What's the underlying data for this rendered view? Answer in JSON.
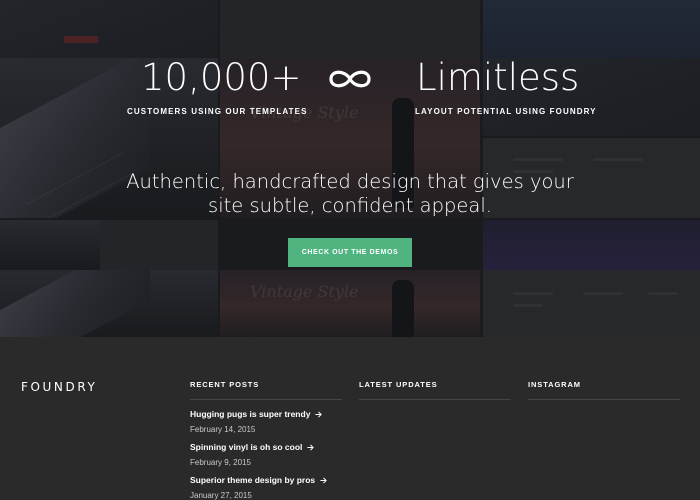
{
  "hero": {
    "stats": [
      {
        "number": "10,000+",
        "caption": "CUSTOMERS USING OUR TEMPLATES"
      },
      {
        "number": "Limitless",
        "caption": "LAYOUT POTENTIAL USING FOUNDRY"
      }
    ],
    "icon": "infinity-icon",
    "headline_line1": "Authentic, handcrafted design that gives your",
    "headline_line2": "site subtle, confident appeal.",
    "cta_label": "CHECK OUT THE DEMOS"
  },
  "footer": {
    "brand": "FOUNDRY",
    "columns": [
      {
        "title": "RECENT POSTS"
      },
      {
        "title": "LATEST UPDATES"
      },
      {
        "title": "INSTAGRAM"
      }
    ],
    "recent_posts": [
      {
        "title": "Hugging pugs is super trendy",
        "date": "February 14, 2015"
      },
      {
        "title": "Spinning vinyl is oh so cool",
        "date": "February 9, 2015"
      },
      {
        "title": "Superior theme design by pros",
        "date": "January 27, 2015"
      }
    ],
    "post_icon": "arrow-right-icon"
  },
  "colors": {
    "accent": "#4fb480",
    "footer_bg": "#2a2a2b",
    "text": "#ffffff"
  }
}
